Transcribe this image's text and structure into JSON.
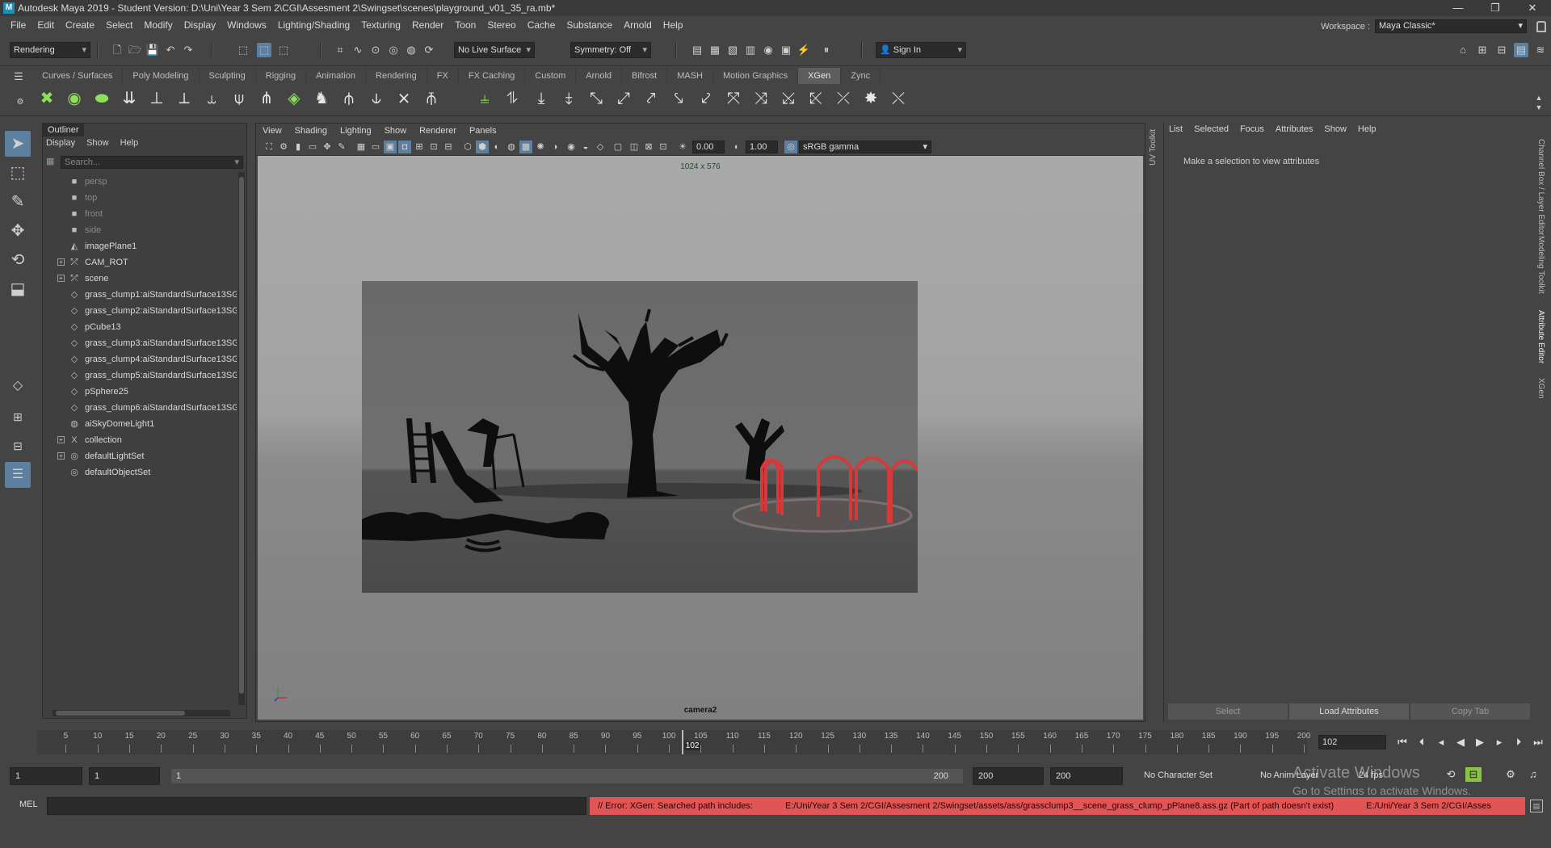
{
  "window": {
    "title": "Autodesk Maya 2019 - Student Version: D:\\Uni\\Year 3 Sem 2\\CGI\\Assesment 2\\Swingset\\scenes\\playground_v01_35_ra.mb*",
    "minimize": "—",
    "restore": "❐",
    "close": "✕"
  },
  "menubar": [
    "File",
    "Edit",
    "Create",
    "Select",
    "Modify",
    "Display",
    "Windows",
    "Lighting/Shading",
    "Texturing",
    "Render",
    "Toon",
    "Stereo",
    "Cache",
    "Substance",
    "Arnold",
    "Help"
  ],
  "workspace": {
    "label": "Workspace :",
    "value": "Maya Classic*"
  },
  "statusline": {
    "menuset": "Rendering",
    "live_surface": "No Live Surface",
    "symmetry": "Symmetry: Off",
    "sign_in": "Sign In"
  },
  "shelf_tabs": [
    "Curves / Surfaces",
    "Poly Modeling",
    "Sculpting",
    "Rigging",
    "Animation",
    "Rendering",
    "FX",
    "FX Caching",
    "Custom",
    "Arnold",
    "Bifrost",
    "MASH",
    "Motion Graphics",
    "XGen",
    "Zync"
  ],
  "active_shelf_tab": "XGen",
  "outliner": {
    "tab": "Outliner",
    "menu": [
      "Display",
      "Show",
      "Help"
    ],
    "search_placeholder": "Search...",
    "items": [
      {
        "name": "persp",
        "dim": true
      },
      {
        "name": "top",
        "dim": true
      },
      {
        "name": "front",
        "dim": true
      },
      {
        "name": "side",
        "dim": true
      },
      {
        "name": "imagePlane1",
        "dim": false
      },
      {
        "name": "CAM_ROT",
        "dim": false,
        "expand": true
      },
      {
        "name": "scene",
        "dim": false,
        "expand": true
      },
      {
        "name": "grass_clump1:aiStandardSurface13SG",
        "dim": false
      },
      {
        "name": "grass_clump2:aiStandardSurface13SG",
        "dim": false
      },
      {
        "name": "pCube13",
        "dim": false
      },
      {
        "name": "grass_clump3:aiStandardSurface13SG",
        "dim": false
      },
      {
        "name": "grass_clump4:aiStandardSurface13SG",
        "dim": false
      },
      {
        "name": "grass_clump5:aiStandardSurface13SG",
        "dim": false
      },
      {
        "name": "pSphere25",
        "dim": false
      },
      {
        "name": "grass_clump6:aiStandardSurface13SG",
        "dim": false
      },
      {
        "name": "aiSkyDomeLight1",
        "dim": false
      },
      {
        "name": "collection",
        "dim": false,
        "expand": true
      },
      {
        "name": "defaultLightSet",
        "dim": false,
        "expand": true
      },
      {
        "name": "defaultObjectSet",
        "dim": false
      }
    ]
  },
  "viewport": {
    "menu": [
      "View",
      "Shading",
      "Lighting",
      "Show",
      "Renderer",
      "Panels"
    ],
    "exposure": "0.00",
    "gamma": "1.00",
    "color_space": "sRGB gamma",
    "resolution": "1024 x 576",
    "camera": "camera2"
  },
  "uv_toolkit": "UV Toolkit",
  "attribute_editor": {
    "menu": [
      "List",
      "Selected",
      "Focus",
      "Attributes",
      "Show",
      "Help"
    ],
    "message": "Make a selection to view attributes",
    "buttons": [
      "Select",
      "Load Attributes",
      "Copy Tab"
    ]
  },
  "side_tabs": [
    "Channel Box / Layer Editor",
    "Modeling Toolkit",
    "Attribute Editor",
    "XGen"
  ],
  "timeslider": {
    "ticks": [
      5,
      10,
      15,
      20,
      25,
      30,
      35,
      40,
      45,
      50,
      55,
      60,
      65,
      70,
      75,
      80,
      85,
      90,
      95,
      100,
      105,
      110,
      115,
      120,
      125,
      130,
      135,
      140,
      145,
      150,
      155,
      160,
      165,
      170,
      175,
      180,
      185,
      190,
      195,
      200
    ],
    "start": 1,
    "end": 200,
    "current": "102",
    "current_input": "102"
  },
  "range": {
    "start": "1",
    "playback_start": "1",
    "slider_start": "1",
    "slider_end": "200",
    "playback_end": "200",
    "end": "200",
    "character_set": "No Character Set",
    "anim_layer": "No Anim Layer",
    "fps": "24 fps"
  },
  "command_line": {
    "label": "MEL",
    "error_parts": [
      "// Error: XGen:  Searched path includes:",
      "E:/Uni/Year 3 Sem 2/CGI/Assesment 2/Swingset/assets/ass/grassclump3__scene_grass_clump_pPlane8.ass.gz (Part of path doesn't exist)",
      "E:/Uni/Year 3 Sem 2/CGI/Asses"
    ]
  },
  "watermark": {
    "line1": "Activate Windows",
    "line2": "Go to Settings to activate Windows."
  },
  "colors": {
    "error": "#e05555",
    "highlight": "#5d7fa0",
    "swing_red": "#d33a3a"
  }
}
